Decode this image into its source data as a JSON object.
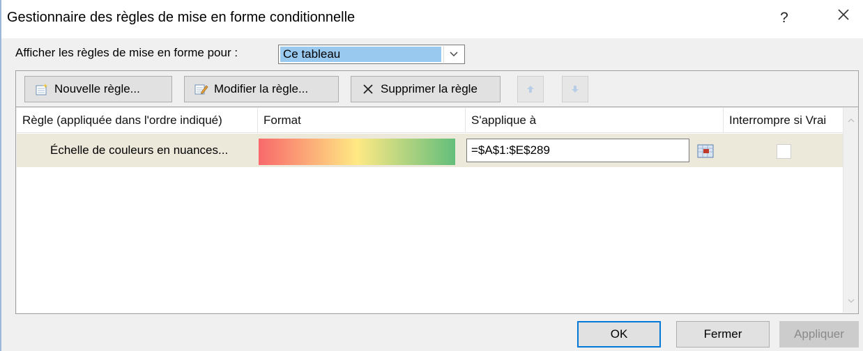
{
  "window": {
    "title": "Gestionnaire des règles de mise en forme conditionnelle",
    "help_label": "?"
  },
  "show_rules": {
    "label": "Afficher les règles de mise en forme pour :",
    "selected": "Ce tableau"
  },
  "toolbar": {
    "new_rule": "Nouvelle règle...",
    "edit_rule": "Modifier la règle...",
    "delete_rule": "Supprimer la règle"
  },
  "grid": {
    "columns": {
      "rule": "Règle (appliquée dans l'ordre indiqué)",
      "format": "Format",
      "applies_to": "S'applique à",
      "stop_if_true": "Interrompre si Vrai"
    },
    "rows": [
      {
        "rule": "Échelle de couleurs en nuances...",
        "format_colors": [
          "#f8696b",
          "#ffe984",
          "#63be7b"
        ],
        "applies_to": "=$A$1:$E$289",
        "stop_if_true": false
      }
    ]
  },
  "footer": {
    "ok": "OK",
    "close": "Fermer",
    "apply": "Appliquer"
  },
  "colors": {
    "selection": "#99c9ef",
    "row_highlight": "#ece9da",
    "default_button_border": "#0078d7"
  }
}
